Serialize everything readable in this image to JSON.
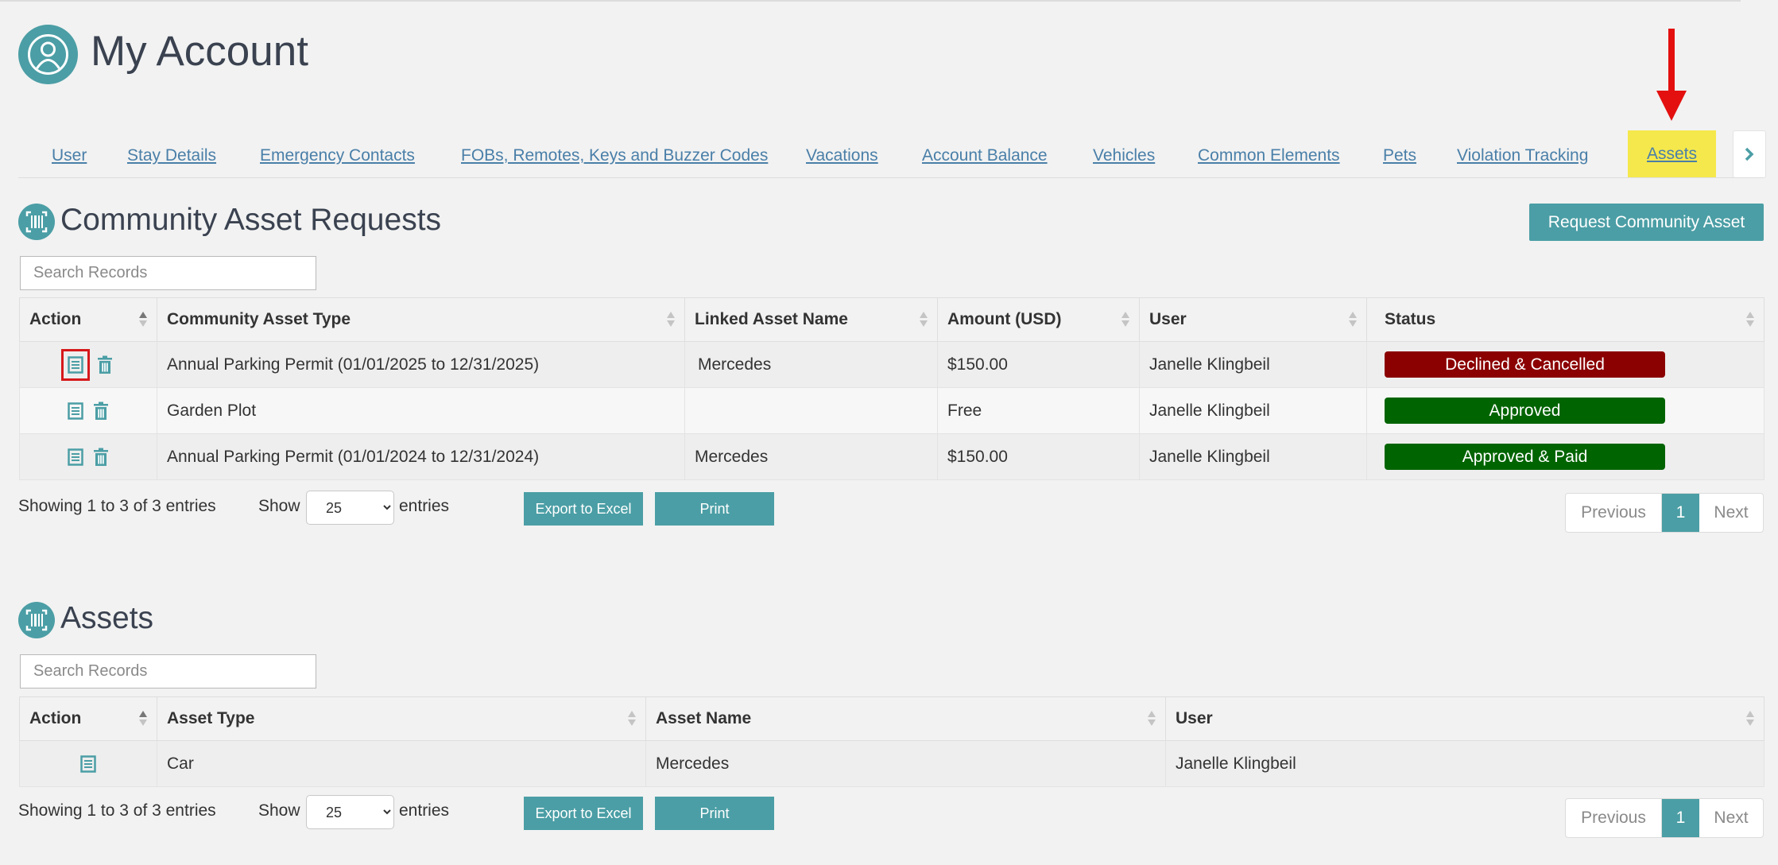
{
  "page": {
    "title": "My Account"
  },
  "tabs": [
    {
      "label": "User"
    },
    {
      "label": "Stay Details"
    },
    {
      "label": "Emergency Contacts"
    },
    {
      "label": "FOBs, Remotes, Keys and Buzzer Codes"
    },
    {
      "label": "Vacations"
    },
    {
      "label": "Account Balance"
    },
    {
      "label": "Vehicles"
    },
    {
      "label": "Common Elements"
    },
    {
      "label": "Pets"
    },
    {
      "label": "Violation Tracking"
    },
    {
      "label": "Assets",
      "active": true
    }
  ],
  "colors": {
    "accent": "#4b9ea5",
    "tab_highlight": "#f5e84c",
    "annotation_red": "#d6191b",
    "declined": "#8b0000",
    "approved": "#006400"
  },
  "requests": {
    "title": "Community Asset Requests",
    "request_button": "Request Community Asset",
    "search_placeholder": "Search Records",
    "columns": [
      "Action",
      "Community Asset Type",
      "Linked Asset Name",
      "Amount (USD)",
      "User",
      "Status"
    ],
    "rows": [
      {
        "type": "Annual Parking Permit (01/01/2025 to 12/31/2025)",
        "linked": "Mercedes",
        "amount": "$150.00",
        "user": "Janelle Klingbeil",
        "status": "Declined & Cancelled",
        "status_color": "#8b0000"
      },
      {
        "type": "Garden Plot",
        "linked": "",
        "amount": "Free",
        "user": "Janelle Klingbeil",
        "status": "Approved",
        "status_color": "#006400"
      },
      {
        "type": "Annual Parking Permit (01/01/2024 to 12/31/2024)",
        "linked": "Mercedes",
        "amount": "$150.00",
        "user": "Janelle Klingbeil",
        "status": "Approved & Paid",
        "status_color": "#006400"
      }
    ],
    "info": "Showing 1 to 3 of 3 entries",
    "show_label": "Show",
    "show_value": "25",
    "entries_label": "entries",
    "export_label": "Export to Excel",
    "print_label": "Print",
    "pagination": {
      "previous": "Previous",
      "current": "1",
      "next": "Next"
    }
  },
  "assets": {
    "title": "Assets",
    "search_placeholder": "Search Records",
    "columns": [
      "Action",
      "Asset Type",
      "Asset Name",
      "User"
    ],
    "rows": [
      {
        "type": "Car",
        "name": "Mercedes",
        "user": "Janelle Klingbeil"
      }
    ],
    "info": "Showing 1 to 3 of 3 entries",
    "show_label": "Show",
    "show_value": "25",
    "entries_label": "entries",
    "export_label": "Export to Excel",
    "print_label": "Print",
    "pagination": {
      "previous": "Previous",
      "current": "1",
      "next": "Next"
    }
  }
}
